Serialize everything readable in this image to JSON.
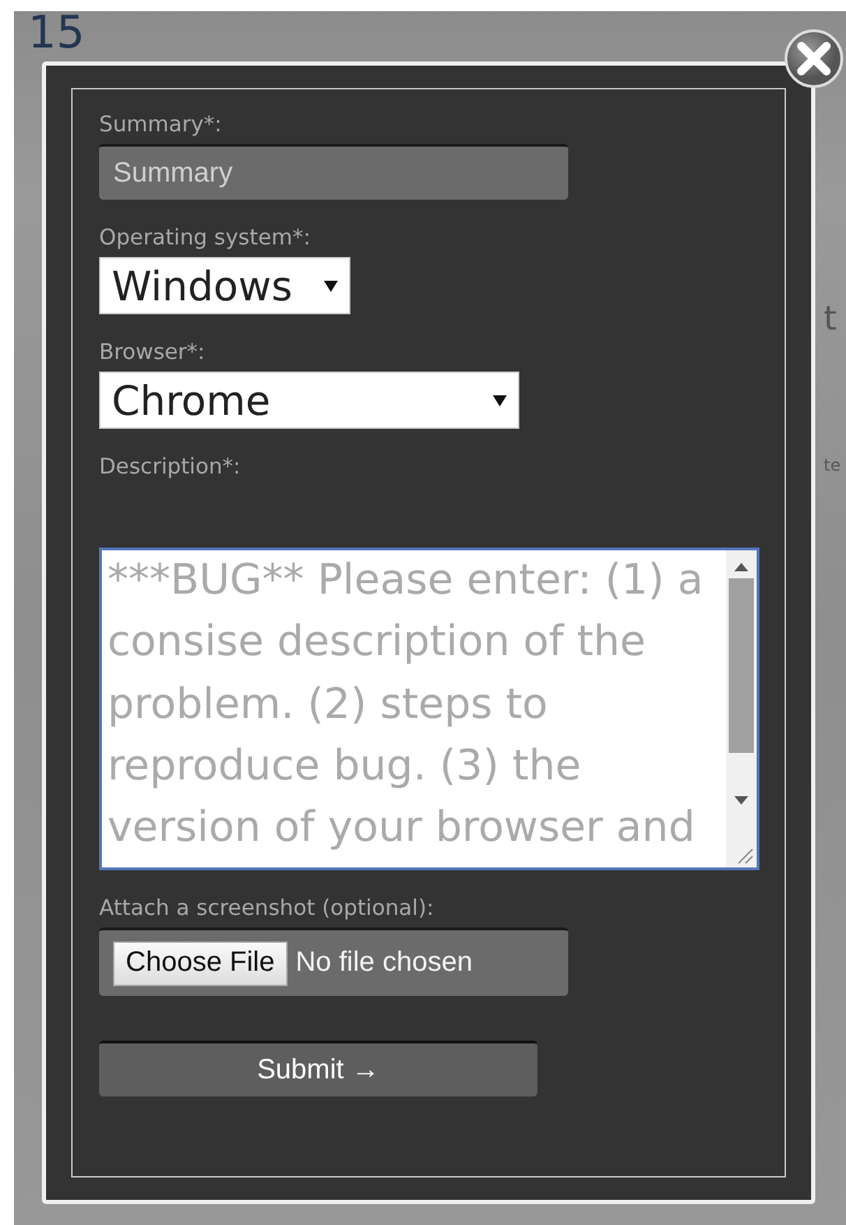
{
  "background_fragments": [
    {
      "text": "15"
    },
    {
      "text": "t"
    },
    {
      "text": "te"
    }
  ],
  "modal": {
    "closable": true,
    "fields": [
      {
        "kind": "text",
        "label": "Summary*:",
        "placeholder": "Summary"
      },
      {
        "kind": "select",
        "label": "Operating system*:",
        "value": "Windows"
      },
      {
        "kind": "select",
        "label": "Browser*:",
        "value": "Chrome"
      },
      {
        "kind": "textarea",
        "label": "Description*:",
        "placeholder": "***BUG** Please enter: (1) a consise description of the problem. (2) steps to reproduce bug. (3) the version of your browser and"
      },
      {
        "kind": "file",
        "label": "Attach a screenshot (optional):",
        "button": "Choose File",
        "value": "No file chosen"
      }
    ],
    "submit": "Submit →"
  }
}
